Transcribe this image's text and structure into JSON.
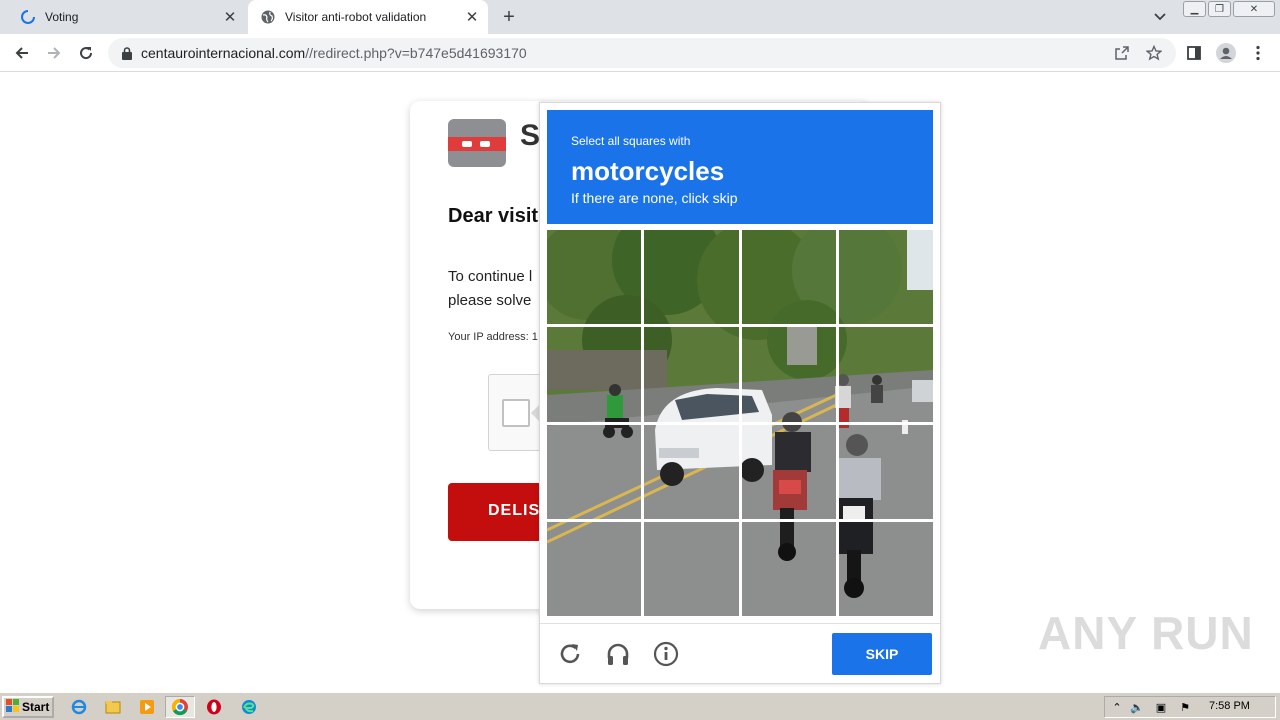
{
  "browser": {
    "tabs": [
      {
        "label": "Voting",
        "icon": "loading-spinner-icon",
        "active": false
      },
      {
        "label": "Visitor anti-robot validation",
        "icon": "globe-icon",
        "active": true
      }
    ],
    "url_host": "centaurointernacional.com",
    "url_path": "//redirect.php?v=b747e5d41693170"
  },
  "page": {
    "logo_letter": "S",
    "heading": "Dear visit",
    "paragraph_line1": "To continue l",
    "paragraph_line2": "please solve",
    "ip_label": "Your IP address: 1",
    "button_label": "DELIS"
  },
  "captcha": {
    "instruction_small": "Select all squares with",
    "target": "motorcycles",
    "instruction_sub": "If there are none, click skip",
    "skip_label": "SKIP",
    "grid_size": 4,
    "accent_color": "#1a73e8"
  },
  "watermark": "ANY RUN",
  "taskbar": {
    "start_label": "Start",
    "clock": "7:58 PM"
  }
}
